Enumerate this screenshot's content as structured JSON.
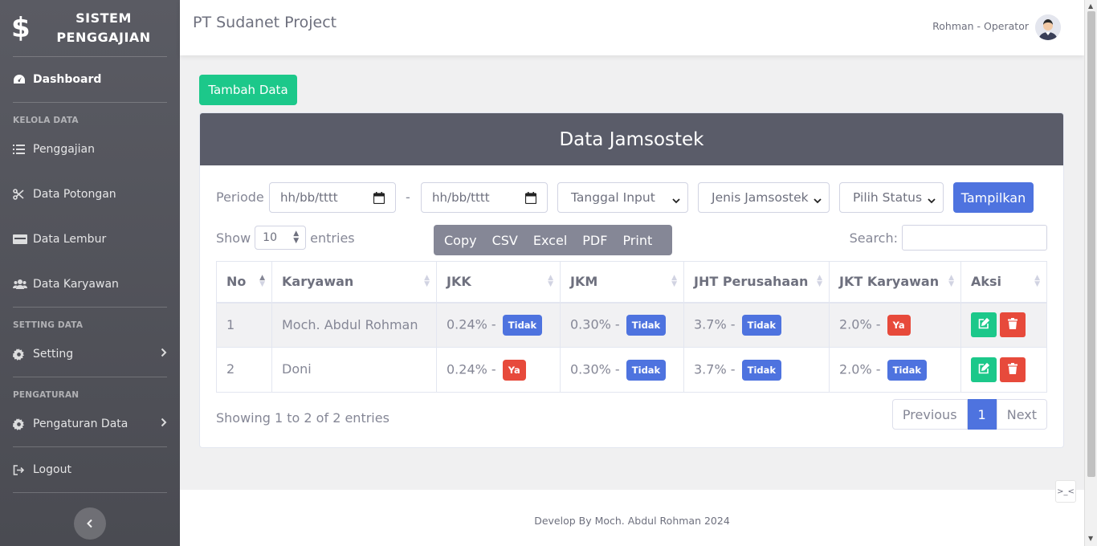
{
  "sidebar": {
    "brand": {
      "icon": "dollar-icon",
      "line1": "SISTEM",
      "line2": "PENGGAJIAN"
    },
    "dashboard_label": "Dashboard",
    "headings": {
      "kelola": "KELOLA DATA",
      "setting": "SETTING DATA",
      "pengaturan": "PENGATURAN"
    },
    "items": {
      "penggajian": "Penggajian",
      "potongan": "Data Potongan",
      "lembur": "Data Lembur",
      "karyawan": "Data Karyawan",
      "setting": "Setting",
      "pengaturan_data": "Pengaturan Data",
      "logout": "Logout"
    }
  },
  "topbar": {
    "project_title": "PT Sudanet Project",
    "user": "Rohman - Operator"
  },
  "add_button": "Tambah Data",
  "card": {
    "title": "Data Jamsostek",
    "filters": {
      "periode_label": "Periode",
      "date_placeholder_from": "hh/bb/tttt",
      "separator": "-",
      "date_placeholder_to": "hh/bb/tttt",
      "tanggal_select": "Tanggal Input",
      "jenis_select": "Jenis Jamsostek",
      "status_select": "Pilih Status",
      "show_button": "Tampilkan"
    },
    "length": {
      "show": "Show",
      "value": "10",
      "entries": "entries"
    },
    "export": {
      "copy": "Copy",
      "csv": "CSV",
      "excel": "Excel",
      "pdf": "PDF",
      "print": "Print"
    },
    "search_label": "Search:",
    "table": {
      "headers": {
        "no": "No",
        "karyawan": "Karyawan",
        "jkk": "JKK",
        "jkm": "JKM",
        "jht": "JHT Perusahaan",
        "jkt": "JKT Karyawan",
        "aksi": "Aksi"
      },
      "rows": [
        {
          "no": "1",
          "name": "Moch. Abdul Rohman",
          "jkk": "0.24% -",
          "jkk_badge": "Tidak",
          "jkm": "0.30% -",
          "jkm_badge": "Tidak",
          "jht": "3.7% -",
          "jht_badge": "Tidak",
          "jkt": "2.0% -",
          "jkt_badge": "Ya"
        },
        {
          "no": "2",
          "name": "Doni",
          "jkk": "0.24% -",
          "jkk_badge": "Ya",
          "jkm": "0.30% -",
          "jkm_badge": "Tidak",
          "jht": "3.7% -",
          "jht_badge": "Tidak",
          "jkt": "2.0% -",
          "jkt_badge": "Tidak"
        }
      ]
    },
    "info": "Showing 1 to 2 of 2 entries",
    "pager": {
      "previous": "Previous",
      "current": "1",
      "next": "Next"
    }
  },
  "footer": "Develop By Moch. Abdul Rohman 2024",
  "colors": {
    "primary": "#4e73df",
    "success": "#1cc88a",
    "danger": "#e74a3b",
    "sidebar": "#4e4f56",
    "card_header": "#5a5c69"
  }
}
